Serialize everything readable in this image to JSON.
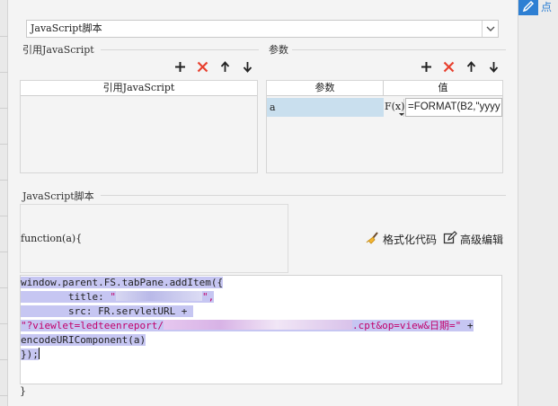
{
  "dropdown": {
    "value": "JavaScript脚本"
  },
  "side_panel": {
    "label": "点"
  },
  "references": {
    "title": "引用JavaScript",
    "column_header": "引用JavaScript",
    "rows": []
  },
  "parameters": {
    "title": "参数",
    "columns": [
      "参数",
      "值"
    ],
    "rows": [
      {
        "name": "a",
        "formula_button": "F(x)",
        "value": "=FORMAT(B2,\"yyyy"
      }
    ]
  },
  "script": {
    "title": "JavaScript脚本",
    "header_line": "function(a){",
    "format_label": "格式化代码",
    "advanced_label": "高级编辑",
    "code": {
      "line1": "window.parent.FS.tabPane.addItem({",
      "line2_key": "        title: ",
      "line2_str_start": "\"",
      "line2_str_end": "\",",
      "line3": "        src: FR.servletURL + ",
      "line4_str_start": "\"?viewlet=ledteenreport/",
      "line4_str_end": ".cpt&op=view&日期=\"",
      "line4_end": " +",
      "line5": "encodeURIComponent(a)",
      "line6": "});"
    },
    "closing": "}"
  },
  "colors": {
    "accent": "#2d7fd3",
    "delete": "#e8402e",
    "selection": "#c6c6f2",
    "string": "#c2006b"
  }
}
